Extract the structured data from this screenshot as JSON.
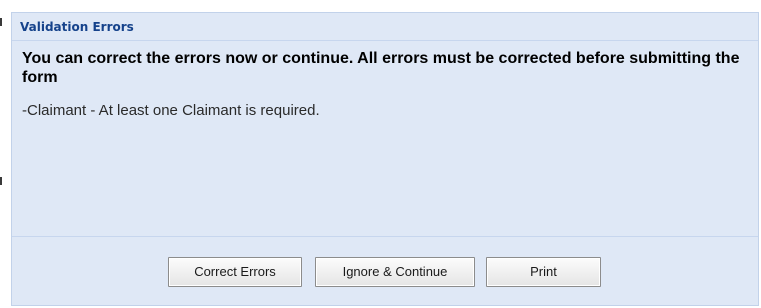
{
  "dialog": {
    "title": "Validation Errors",
    "headline": "You can correct the errors now or continue. All errors must be corrected before submitting the form",
    "errors": [
      "-Claimant - At least one Claimant is required."
    ]
  },
  "buttons": {
    "correct_label": "Correct Errors",
    "ignore_label": "Ignore & Continue",
    "print_label": "Print"
  },
  "colors": {
    "dialog_background": "#dfe8f6",
    "title_text": "#15428b",
    "border": "#c2d2ea"
  }
}
